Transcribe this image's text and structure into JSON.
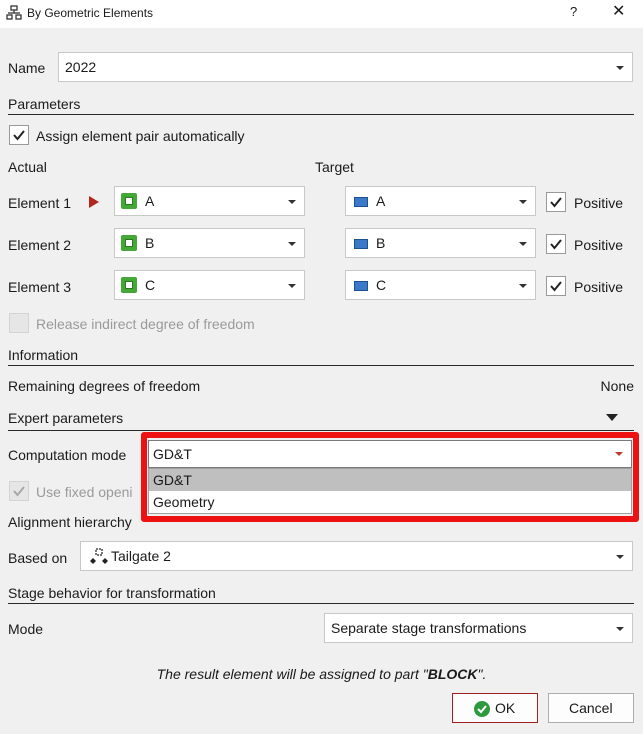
{
  "window": {
    "title": "By Geometric Elements",
    "help_label": "?",
    "close_label": "✕"
  },
  "name_field": {
    "label": "Name",
    "value": "2022"
  },
  "parameters": {
    "section_label": "Parameters",
    "assign_auto_label": "Assign element pair automatically",
    "assign_auto_checked": true,
    "actual_header": "Actual",
    "target_header": "Target",
    "elements": [
      {
        "label": "Element 1",
        "actual": "A",
        "target": "A",
        "positive_label": "Positive",
        "positive_checked": true
      },
      {
        "label": "Element 2",
        "actual": "B",
        "target": "B",
        "positive_label": "Positive",
        "positive_checked": true
      },
      {
        "label": "Element 3",
        "actual": "C",
        "target": "C",
        "positive_label": "Positive",
        "positive_checked": true
      }
    ],
    "release_label": "Release indirect degree of freedom"
  },
  "information": {
    "section_label": "Information",
    "remaining_label": "Remaining degrees of freedom",
    "remaining_value": "None"
  },
  "expert": {
    "section_label": "Expert parameters",
    "computation_label": "Computation mode",
    "computation_value": "GD&T",
    "options": [
      "GD&T",
      "Geometry"
    ],
    "use_fixed_label": "Use fixed openi"
  },
  "alignment": {
    "section_label": "Alignment hierarchy",
    "based_on_label": "Based on",
    "based_on_value": "Tailgate 2"
  },
  "stage": {
    "section_label": "Stage behavior for transformation",
    "mode_label": "Mode",
    "mode_value": "Separate stage transformations"
  },
  "footer": {
    "note_prefix": "The result element will be assigned to part \"",
    "note_part": "BLOCK",
    "note_suffix": "\".",
    "ok_label": "OK",
    "cancel_label": "Cancel"
  },
  "colors": {
    "highlight": "#ee1111",
    "ok_border": "#a31f1f",
    "check_green": "#2e9a3e"
  }
}
